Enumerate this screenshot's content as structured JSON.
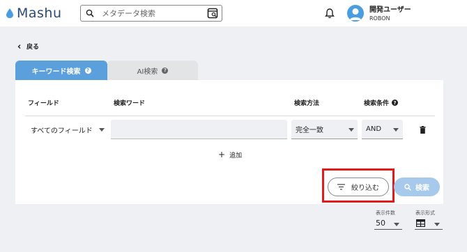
{
  "header": {
    "logo_text": "Mashu",
    "search": {
      "placeholder": "メタデータ検索",
      "value": ""
    },
    "user": {
      "name": "開発ユーザー",
      "org": "ROBON"
    }
  },
  "nav": {
    "back_label": "戻る"
  },
  "tabs": [
    {
      "label": "キーワード検索",
      "active": true
    },
    {
      "label": "AI検索",
      "active": false
    }
  ],
  "table": {
    "headers": [
      "フィールド",
      "検索ワード",
      "検索方法",
      "検索条件"
    ],
    "row": {
      "field": "すべてのフィールド",
      "word": "",
      "method": "完全一致",
      "condition": "AND"
    }
  },
  "add_label": "追加",
  "buttons": {
    "filter_label": "絞り込む",
    "search_label": "検索"
  },
  "display": {
    "count_label": "表示件数",
    "count_value": "50",
    "format_label": "表示形式"
  },
  "colors": {
    "accent": "#5b9fdd",
    "highlight": "#e01b1b",
    "brand": "#2a4a7c"
  }
}
